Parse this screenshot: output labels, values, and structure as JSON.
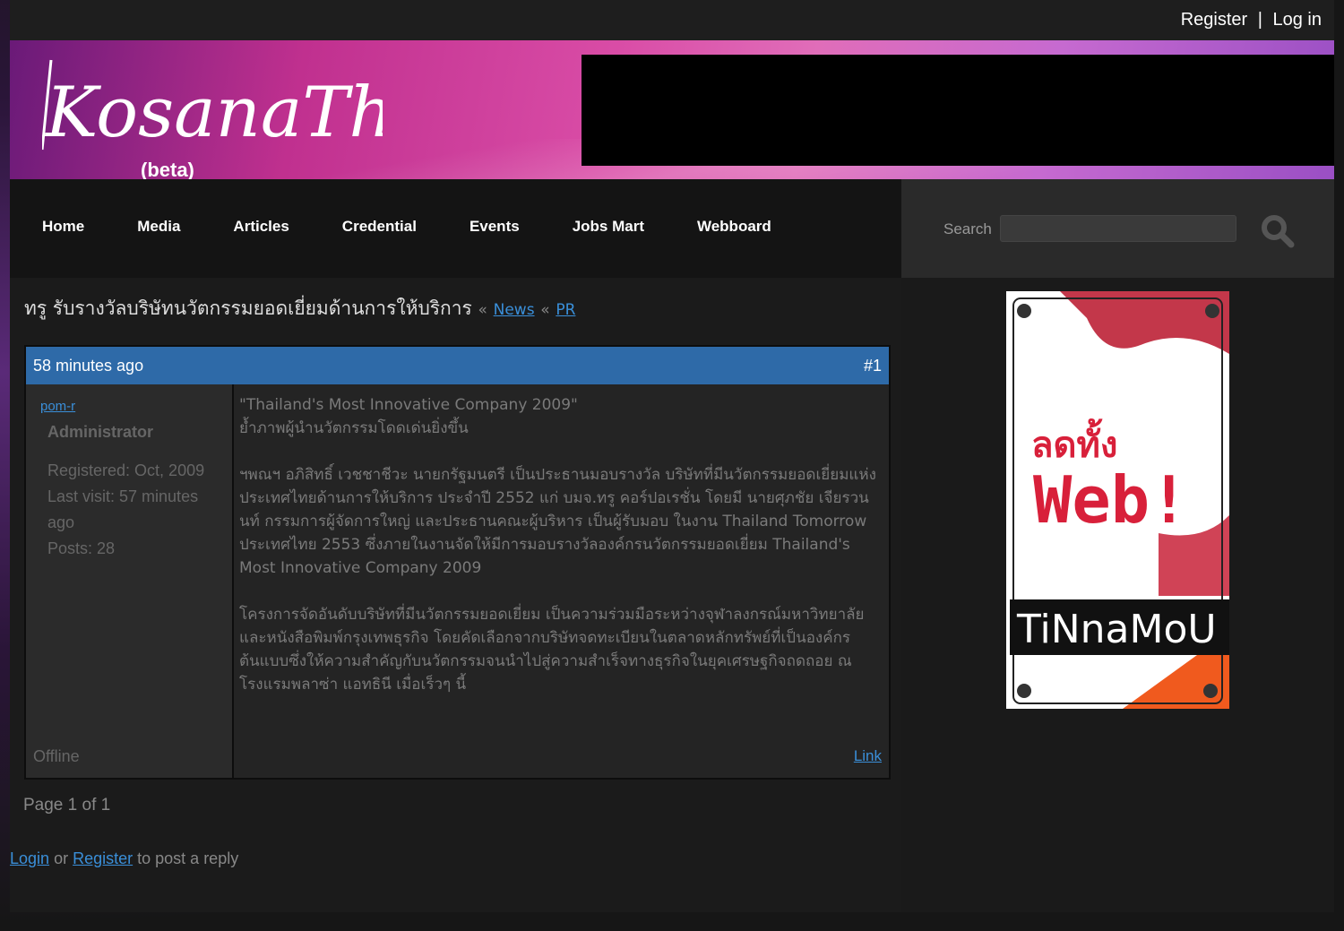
{
  "header": {
    "register": "Register",
    "separator": "|",
    "login": "Log in"
  },
  "banner": {
    "logo_text": "KosanaThai",
    "beta": "(beta)"
  },
  "nav": {
    "items": [
      "Home",
      "Media",
      "Articles",
      "Credential",
      "Events",
      "Jobs Mart",
      "Webboard"
    ]
  },
  "search": {
    "label": "Search",
    "value": ""
  },
  "topic": {
    "title": "ทรู รับรางวัลบริษัทนวัตกรรมยอดเยี่ยมด้านการให้บริการ",
    "crumb_sep": "«",
    "crumb_1": "News",
    "crumb_2": "PR"
  },
  "post": {
    "time": "58 minutes ago",
    "number": "#1",
    "username": "pom-r",
    "role": "Administrator",
    "registered": "Registered: Oct, 2009",
    "last_visit": "Last visit: 57 minutes ago",
    "posts": "Posts: 28",
    "status": "Offline",
    "link": "Link",
    "para1_line1": "\"Thailand's Most Innovative Company 2009\"",
    "para1_line2": "ย้ำภาพผู้นำนวัตกรรมโดดเด่นยิ่งขึ้น",
    "para2": "ฯพณฯ อภิสิทธิ์ เวชชาชีวะ นายกรัฐมนตรี เป็นประธานมอบรางวัล บริษัทที่มีนวัตกรรมยอดเยี่ยมแห่งประเทศไทยด้านการให้บริการ ประจำปี 2552 แก่ บมจ.ทรู คอร์ปอเรชั่น โดยมี นายศุภชัย เจียรวนนท์ กรรมการผู้จัดการใหญ่ และประธานคณะผู้บริหาร เป็นผู้รับมอบ ในงาน Thailand Tomorrow ประเทศไทย 2553 ซึ่งภายในงานจัดให้มีการมอบรางวัลองค์กรนวัตกรรมยอดเยี่ยม Thailand's Most Innovative Company 2009",
    "para3": "โครงการจัดอันดับบริษัทที่มีนวัตกรรมยอดเยี่ยม เป็นความร่วมมือระหว่างจุฬาลงกรณ์มหาวิทยาลัยและหนังสือพิมพ์กรุงเทพธุรกิจ โดยคัดเลือกจากบริษัทจดทะเบียนในตลาดหลักทรัพย์ที่เป็นองค์กรต้นแบบซึ่งให้ความสำคัญกับนวัตกรรมจนนำไปสู่ความสำเร็จทางธุรกิจในยุคเศรษฐกิจถดถอย ณ โรงแรมพลาซ่า แอทธินี เมื่อเร็วๆ นี้"
  },
  "pagination": {
    "text": "Page 1 of 1"
  },
  "reply": {
    "login": "Login",
    "or": "or",
    "register": "Register",
    "suffix": "to post a reply"
  },
  "ad": {
    "headline_thai": "ลดทั้ง",
    "headline_web": "Web!",
    "brand": "TiNnaMoU"
  },
  "colors": {
    "accent_blue": "#2e6aa8",
    "link_blue": "#3a8fd9",
    "banner_pink": "#d94ca6"
  }
}
